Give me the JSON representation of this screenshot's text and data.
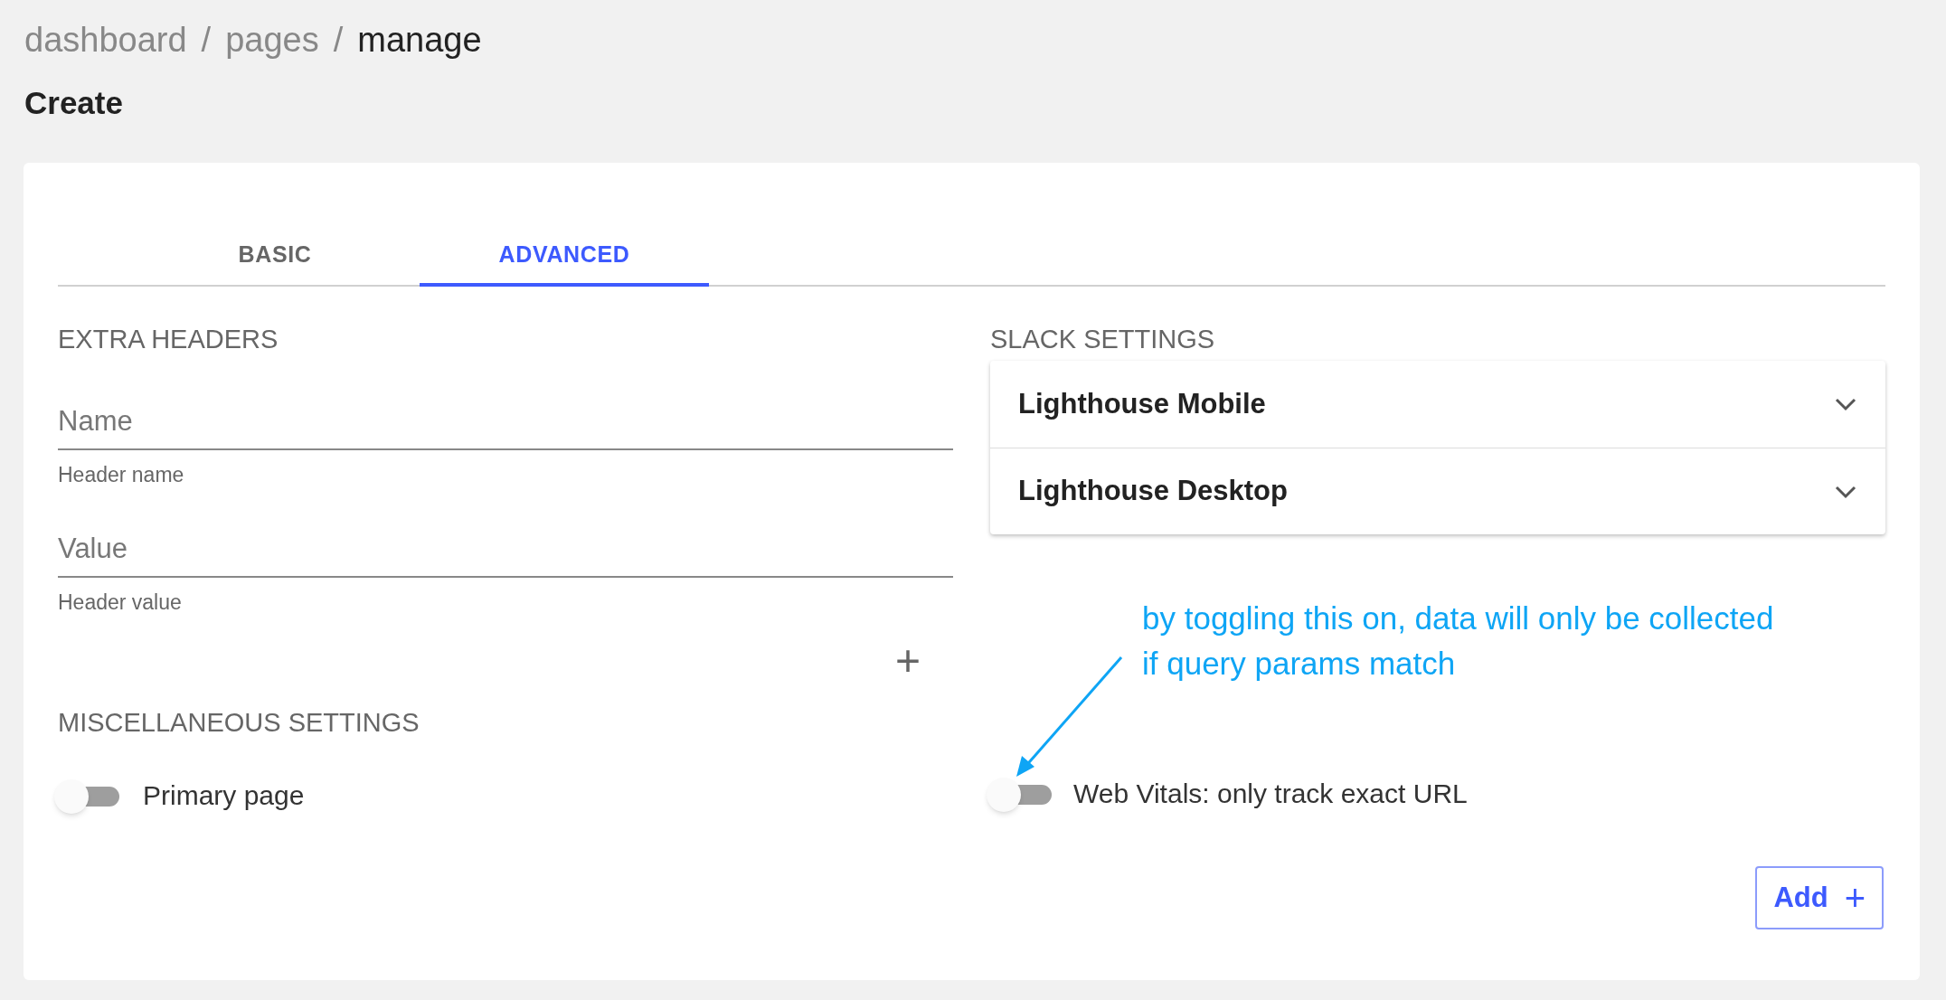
{
  "breadcrumb": [
    {
      "label": "dashboard",
      "current": false
    },
    {
      "label": "/",
      "current": false
    },
    {
      "label": "pages",
      "current": false
    },
    {
      "label": "/",
      "current": false
    },
    {
      "label": "manage",
      "current": true
    }
  ],
  "title": "Create",
  "tabs": [
    {
      "label": "BASIC",
      "selected": false
    },
    {
      "label": "ADVANCED",
      "selected": true
    }
  ],
  "extra_headers": {
    "heading": "EXTRA HEADERS",
    "fields": [
      {
        "placeholder": "Name",
        "helper": "Header name"
      },
      {
        "placeholder": "Value",
        "helper": "Header value"
      }
    ],
    "add_icon": "+"
  },
  "misc": {
    "heading": "MISCELLANEOUS SETTINGS",
    "switch": {
      "label": "Primary page",
      "on": false
    }
  },
  "slack": {
    "heading": "SLACK SETTINGS",
    "items": [
      {
        "label": "Lighthouse Mobile",
        "expanded": false
      },
      {
        "label": "Lighthouse Desktop",
        "expanded": false
      }
    ]
  },
  "annotation": {
    "lines": [
      "by toggling this on, data will only be collected",
      "if query params match"
    ]
  },
  "web_vitals": {
    "label": "Web Vitals: only track exact URL",
    "on": false
  },
  "add_button": {
    "label": "Add",
    "icon": "+"
  }
}
